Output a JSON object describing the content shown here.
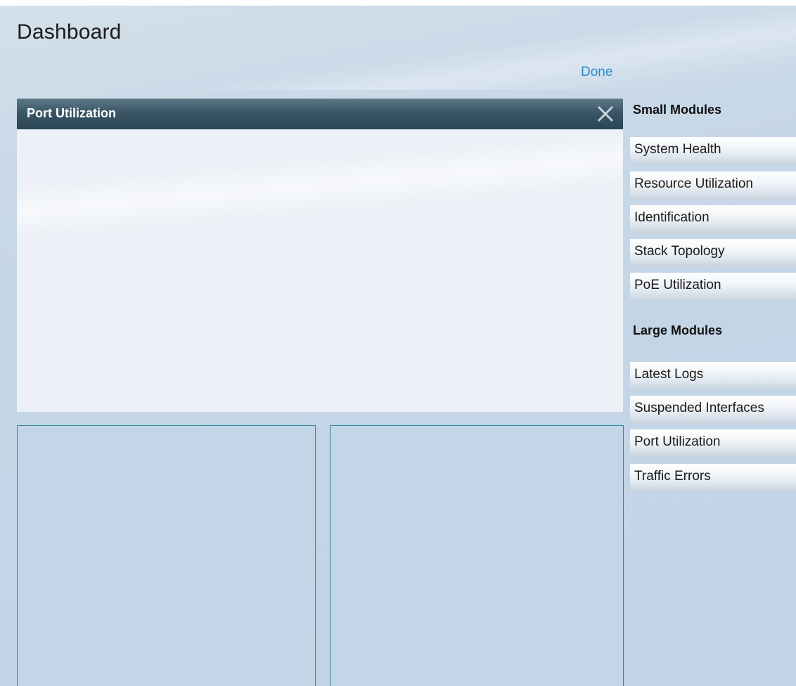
{
  "page": {
    "title": "Dashboard",
    "done_label": "Done"
  },
  "modules": {
    "large_module": {
      "title": "Port Utilization"
    }
  },
  "palette": {
    "small_heading": "Small Modules",
    "small_items": [
      {
        "label": "System Health"
      },
      {
        "label": "Resource Utilization"
      },
      {
        "label": "Identification"
      },
      {
        "label": "Stack Topology"
      },
      {
        "label": "PoE Utilization"
      }
    ],
    "large_heading": "Large Modules",
    "large_items": [
      {
        "label": "Latest Logs"
      },
      {
        "label": "Suspended Interfaces"
      },
      {
        "label": "Port Utilization"
      },
      {
        "label": "Traffic Errors"
      }
    ]
  },
  "colors": {
    "accent_link": "#2a8bc8",
    "header_dark": "#2a4554",
    "slot_border": "#2c8a9a",
    "background": "#c3d5e6"
  }
}
